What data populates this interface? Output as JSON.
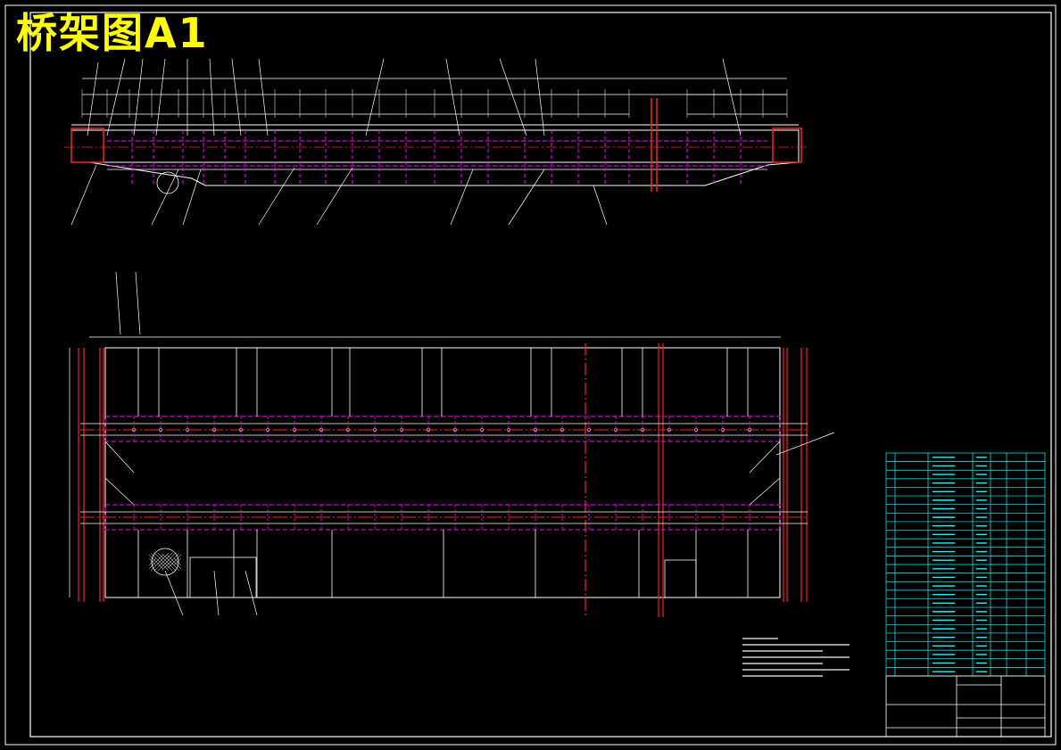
{
  "drawing": {
    "title": "桥架图A1",
    "colors": {
      "frame": "#ffffff",
      "dashed": "#ff00ff",
      "center": "#ff2020",
      "dim": "#ffffff",
      "table": "#00ffff",
      "title": "#ffff00"
    }
  },
  "table": {
    "rows": 26
  },
  "notes": {
    "lines": 7
  }
}
